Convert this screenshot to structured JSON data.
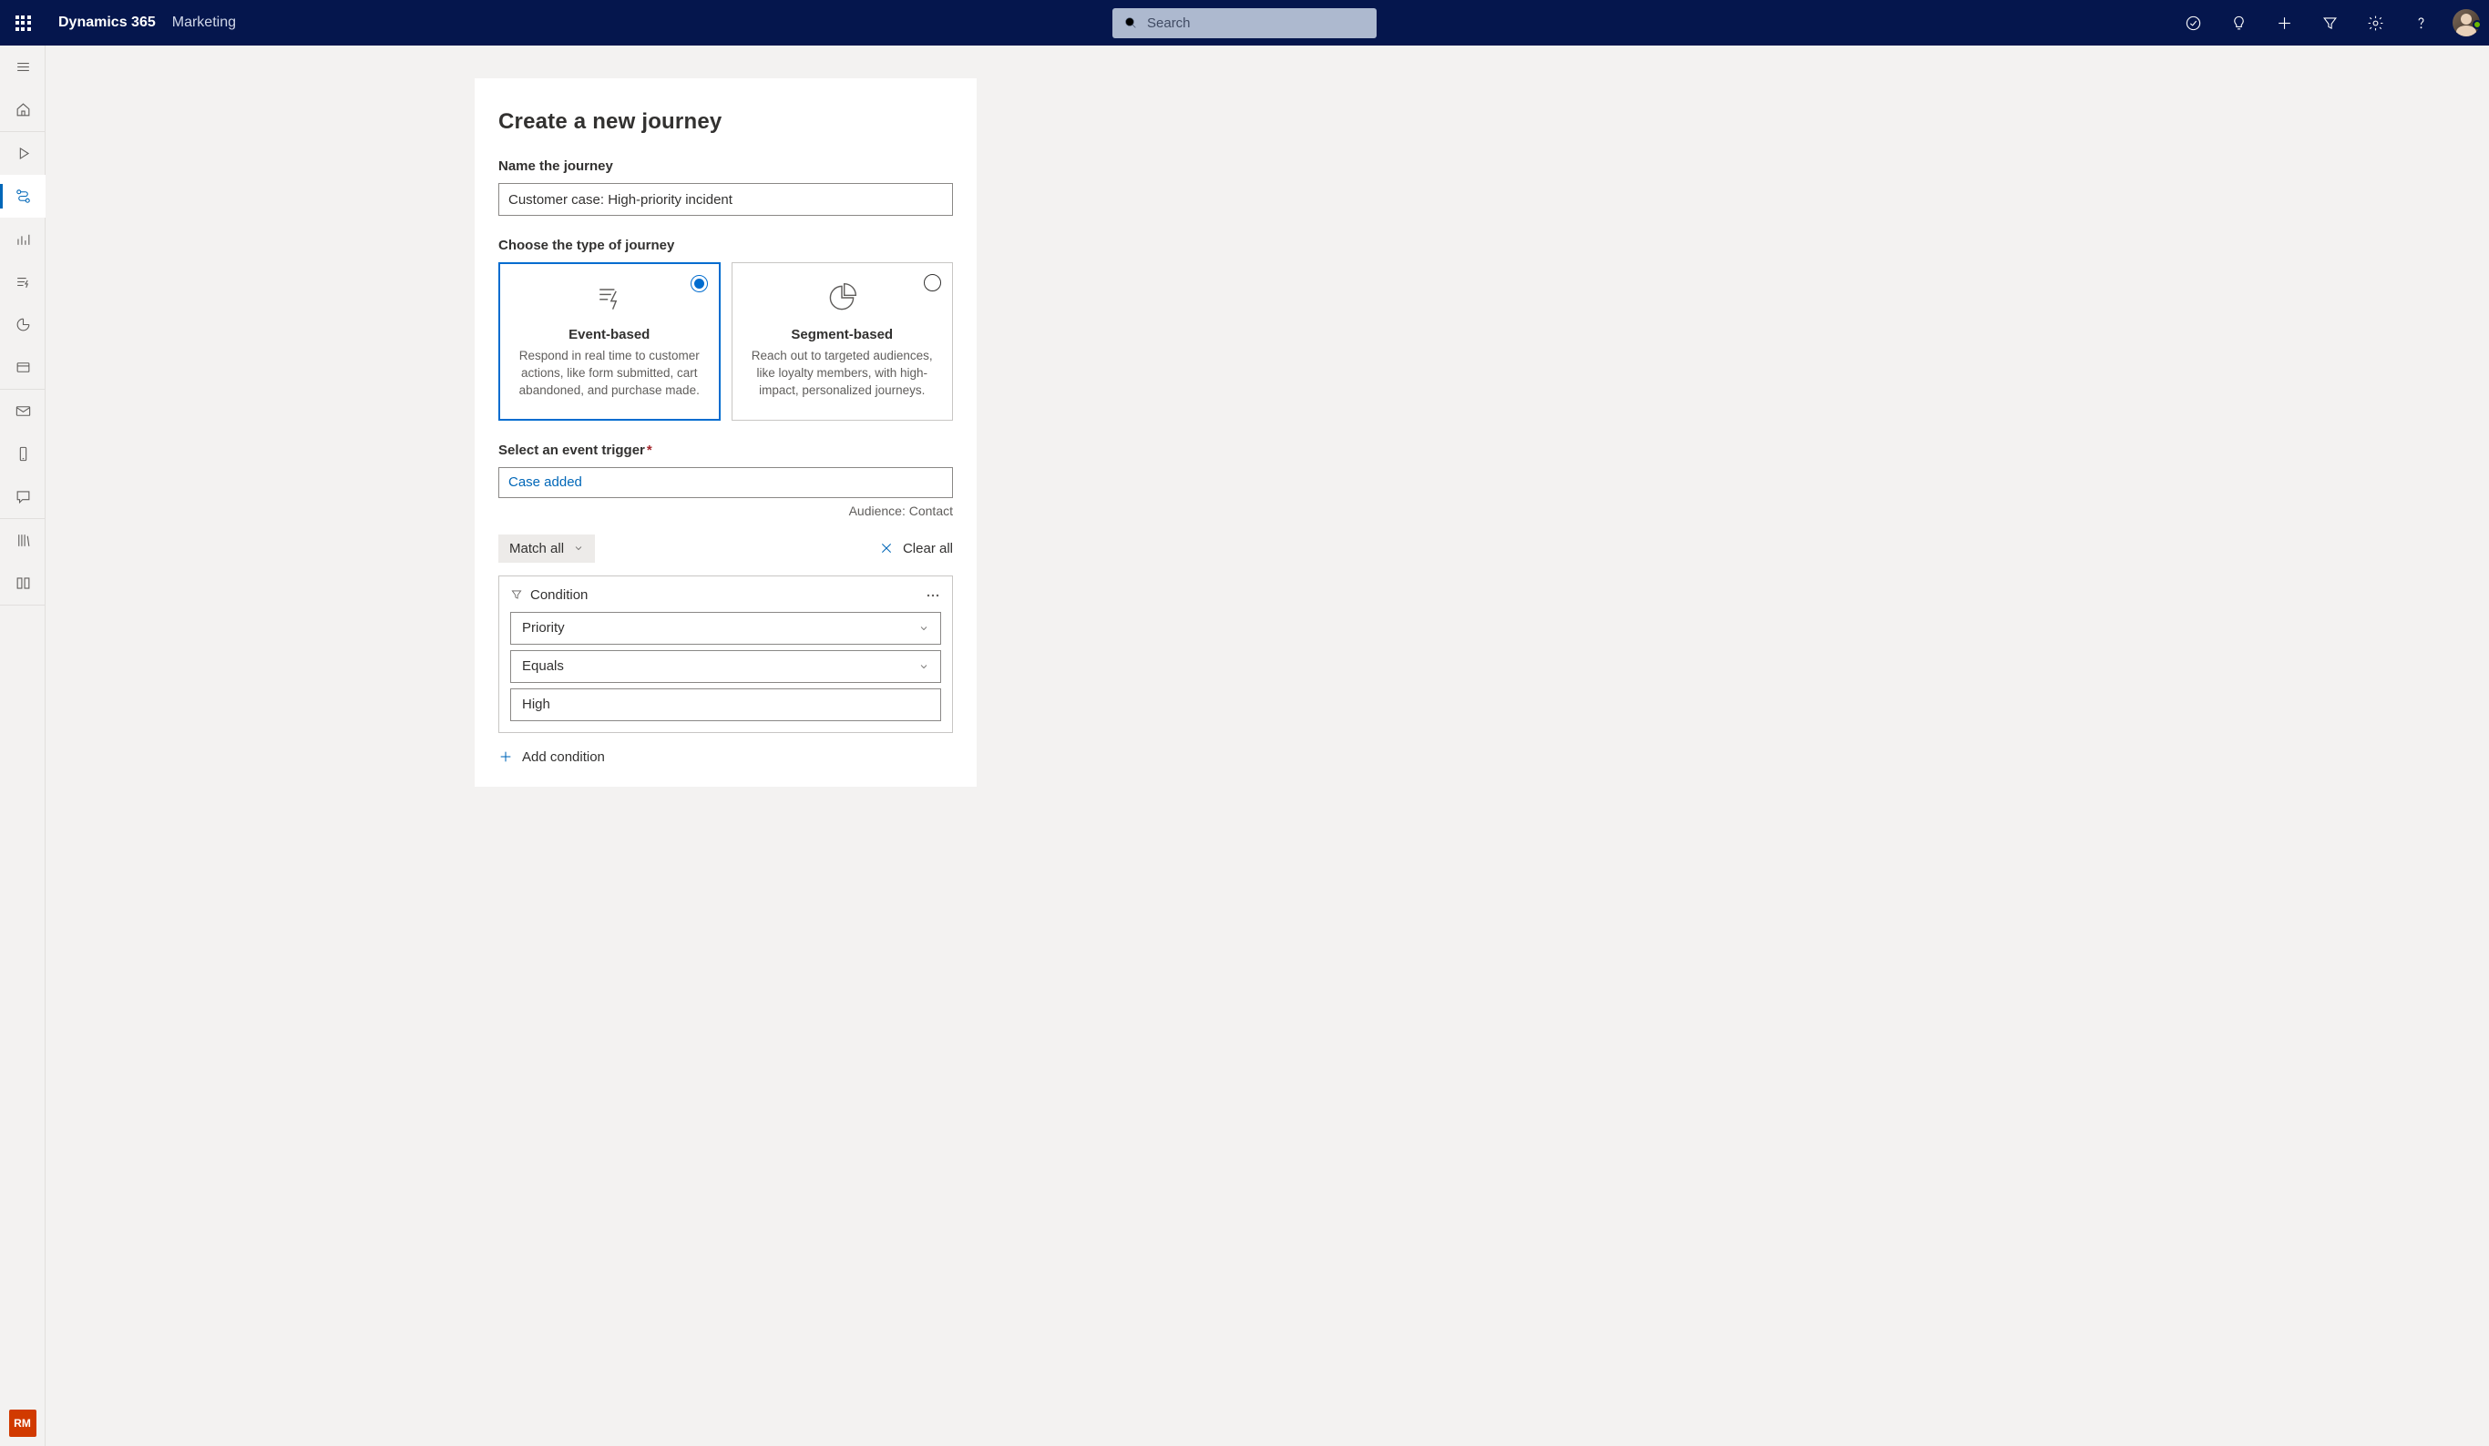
{
  "topbar": {
    "brand": "Dynamics 365",
    "module": "Marketing",
    "search_placeholder": "Search"
  },
  "siderail": {
    "rm_badge": "RM"
  },
  "panel": {
    "title": "Create a new journey",
    "name_label": "Name the journey",
    "name_value": "Customer case: High-priority incident",
    "type_label": "Choose the type of journey",
    "types": [
      {
        "title": "Event-based",
        "desc": "Respond in real time to customer actions, like form submitted, cart abandoned, and purchase made.",
        "selected": true
      },
      {
        "title": "Segment-based",
        "desc": "Reach out to targeted audiences, like loyalty members, with high-impact, personalized journeys.",
        "selected": false
      }
    ],
    "trigger_label": "Select an event trigger",
    "trigger_value": "Case added",
    "audience_hint": "Audience: Contact",
    "match_label": "Match all",
    "clear_label": "Clear all",
    "condition_label": "Condition",
    "condition": {
      "field": "Priority",
      "operator": "Equals",
      "value": "High"
    },
    "add_condition_label": "Add condition"
  }
}
